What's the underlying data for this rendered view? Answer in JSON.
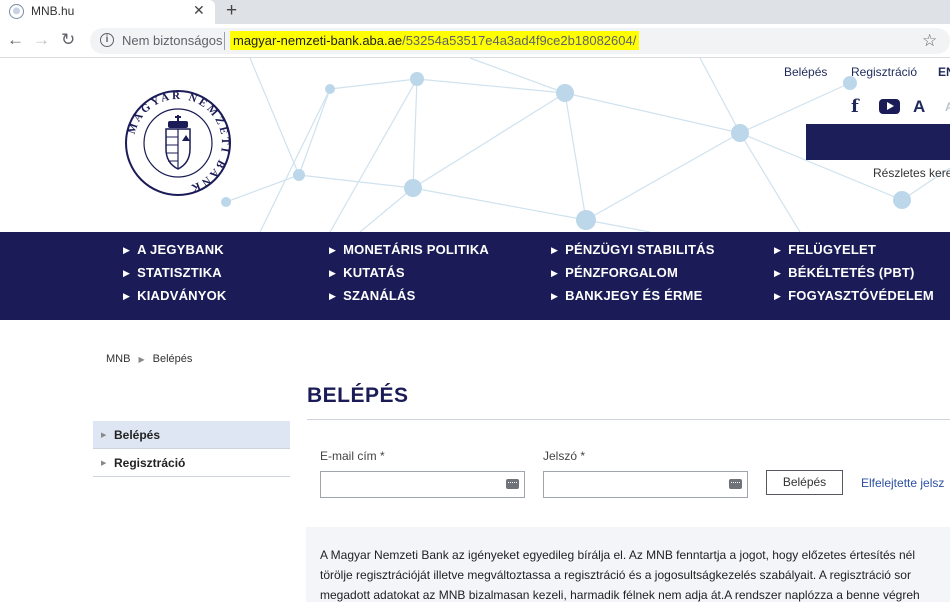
{
  "browser": {
    "tab_title": "MNB.hu",
    "tab_close": "✕",
    "new_tab": "+",
    "security_label": "Nem biztonságos",
    "url_host": "magyar-nemzeti-bank.aba.ae",
    "url_path": "/53254a53517e4a3ad4f9ce2b18082604/"
  },
  "header": {
    "login_link": "Belépés",
    "register_link": "Regisztráció",
    "language": "EN",
    "detailed_search": "Részletes kere",
    "logo_text": "MAGYAR NEMZETI BANK"
  },
  "nav": {
    "col1": [
      "A JEGYBANK",
      "STATISZTIKA",
      "KIADVÁNYOK"
    ],
    "col2": [
      "MONETÁRIS POLITIKA",
      "KUTATÁS",
      "SZANÁLÁS"
    ],
    "col3": [
      "PÉNZÜGYI STABILITÁS",
      "PÉNZFORGALOM",
      "BANKJEGY ÉS ÉRME"
    ],
    "col4": [
      "FELÜGYELET",
      "BÉKÉLTETÉS (PBT)",
      "FOGYASZTÓVÉDELEM"
    ]
  },
  "breadcrumb": {
    "home": "MNB",
    "current": "Belépés"
  },
  "page": {
    "title": "BELÉPÉS"
  },
  "sidebar": {
    "items": [
      {
        "label": "Belépés",
        "active": true
      },
      {
        "label": "Regisztráció",
        "active": false
      }
    ]
  },
  "form": {
    "email_label": "E-mail cím *",
    "email_value": "",
    "password_label": "Jelszó *",
    "password_value": "",
    "submit_label": "Belépés",
    "forgot_label": "Elfelejtette jelsz"
  },
  "info": {
    "lines": [
      "A Magyar Nemzeti Bank az igényeket egyedileg bírálja el. Az MNB fenntartja a jogot, hogy előzetes értesítés nél",
      "törölje regisztrációját illetve megváltoztassa a regisztráció és a jogosultságkezelés szabályait. A regisztráció sor",
      "megadott adatokat az MNB bizalmasan kezeli, harmadik félnek nem adja át.A rendszer naplózza a benne végreh"
    ]
  },
  "colors": {
    "navy": "#1b1c57",
    "link": "#2b4fa0",
    "url_highlight": "#ffff00"
  }
}
